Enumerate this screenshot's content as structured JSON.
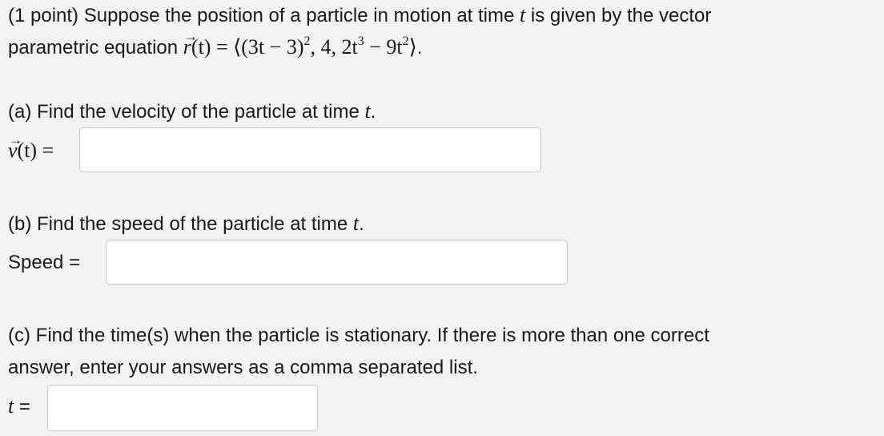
{
  "problem": {
    "intro_1": "(1 point) Suppose the position of a particle in motion at time ",
    "t_var": "t",
    "intro_2": " is given by the vector",
    "intro_line2": "parametric equation ",
    "r_symbol": "r",
    "r_args": "(t) = ",
    "equation_a": "⟨(3t − 3)",
    "exp_2": "2",
    "equation_b": ", 4, 2t",
    "exp_3": "3",
    "equation_c": " − 9t",
    "exp_2b": "2",
    "equation_d": "⟩",
    "period": "."
  },
  "part_a": {
    "prompt": "(a) Find the velocity of the particle at time ",
    "t_var": "t",
    "period": ".",
    "v_symbol": "v",
    "v_label_rest": "(t) =",
    "input_value": ""
  },
  "part_b": {
    "prompt": "(b) Find the speed of the particle at time ",
    "t_var": "t",
    "period": ".",
    "label": "Speed =",
    "input_value": ""
  },
  "part_c": {
    "prompt_line1": "(c) Find the time(s) when the particle is stationary. If there is more than one correct",
    "prompt_line2": "answer, enter your answers as a comma separated list.",
    "t_var": "t",
    "label_rest": " =",
    "input_value": ""
  }
}
